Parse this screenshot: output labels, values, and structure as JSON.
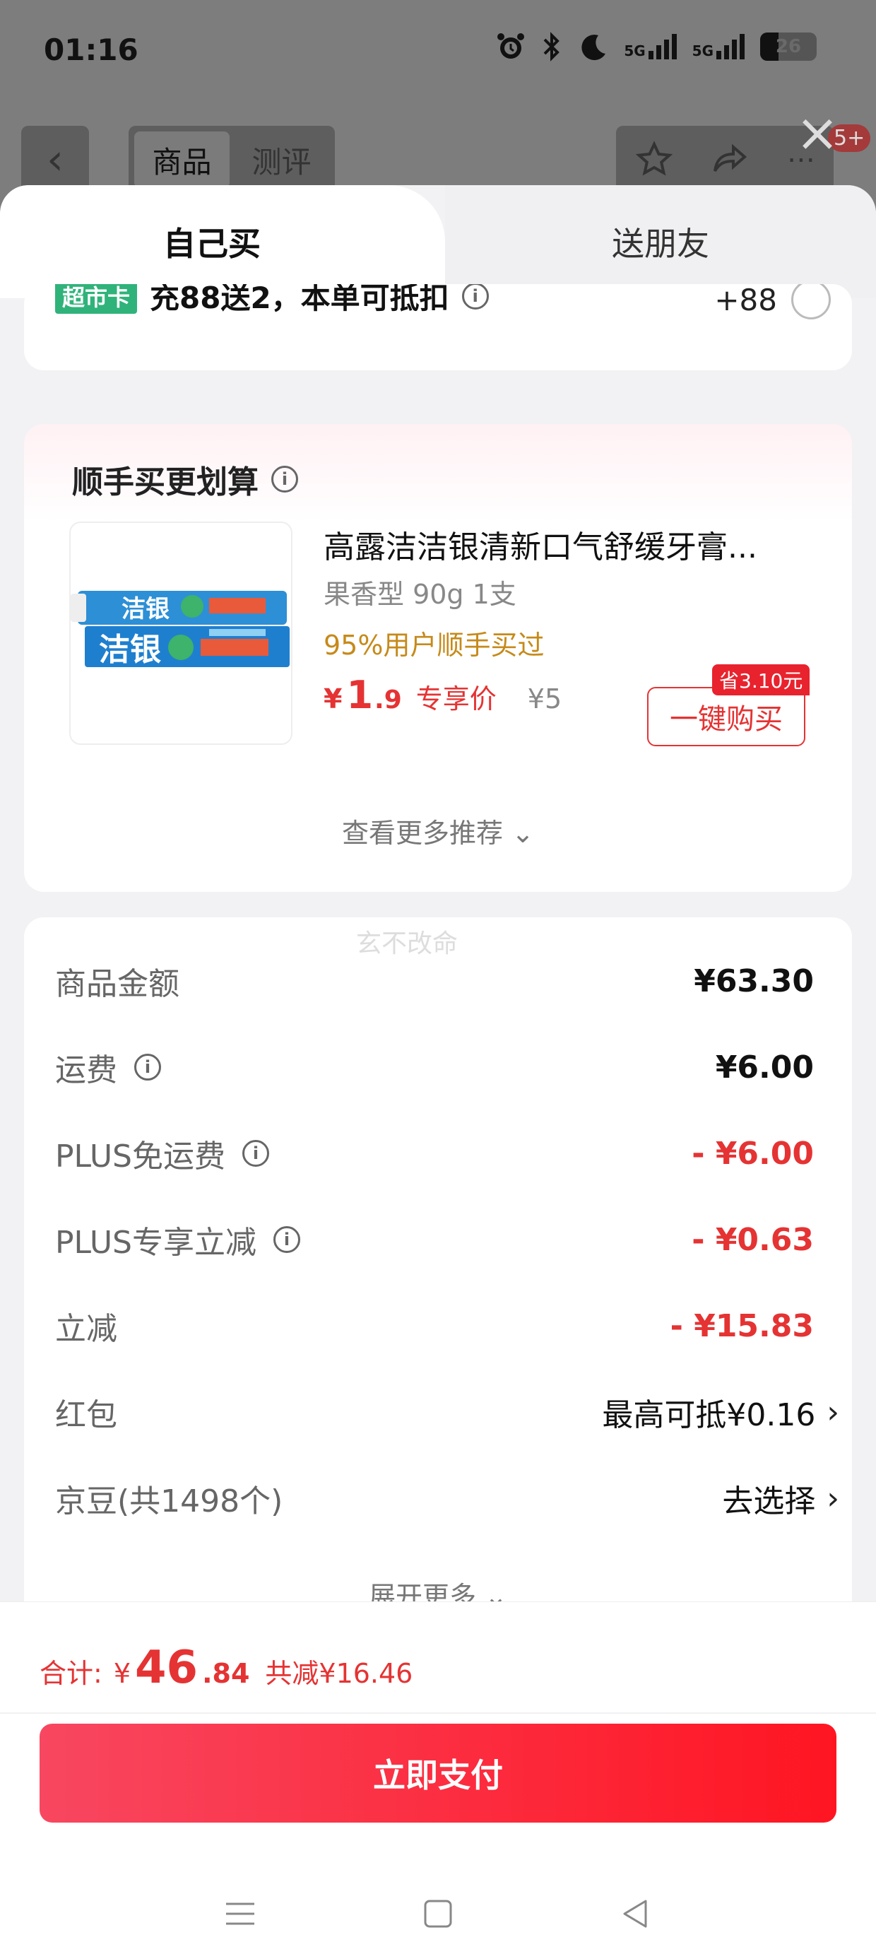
{
  "status_bar": {
    "time": "01:16",
    "network1": "5G",
    "network2": "5G",
    "battery": "26"
  },
  "background_page": {
    "tabs": [
      "商品",
      "测评"
    ],
    "badge": "5+"
  },
  "sheet": {
    "mode_tabs": {
      "self": "自己买",
      "gift": "送朋友"
    },
    "chaoshi": {
      "tag": "超市卡",
      "text": "充88送2，本单可抵扣",
      "amount": "+88"
    },
    "recommend": {
      "title": "顺手买更划算",
      "product": {
        "name": "高露洁洁银清新口气舒缓牙膏...",
        "spec": "果香型 90g 1支",
        "hint": "95%用户顺手买过",
        "price_yen": "¥",
        "price_int": "1",
        "price_dec": ".9",
        "price_label": "专享价",
        "orig_price": "¥5",
        "save_tag": "省3.10元",
        "buy_label": "一键购买",
        "image_brand": "洁银"
      },
      "more": "查看更多推荐"
    },
    "fees": {
      "watermark": "玄不改命",
      "rows": [
        {
          "label": "商品金额",
          "value": "¥63.30"
        },
        {
          "label": "运费",
          "value": "¥6.00"
        },
        {
          "label": "PLUS免运费",
          "value": "- ¥6.00"
        },
        {
          "label": "PLUS专享立减",
          "value": "- ¥0.63"
        },
        {
          "label": "立减",
          "value": "- ¥15.83"
        },
        {
          "label": "红包",
          "value": "最高可抵¥0.16"
        },
        {
          "label": "京豆(共1498个)",
          "value": "去选择"
        }
      ],
      "expand": "展开更多"
    }
  },
  "bottom": {
    "total_label": "合计:",
    "total_yen": "¥",
    "total_int": "46",
    "total_dec": ".84",
    "total_save": "共减¥16.46",
    "pay_label": "立即支付"
  },
  "colors": {
    "accent_red": "#e53333",
    "pay_gradient_start": "#f84760",
    "pay_gradient_end": "#ff1522",
    "tag_green": "#2fb37a",
    "hint_orange": "#c68a1a"
  }
}
